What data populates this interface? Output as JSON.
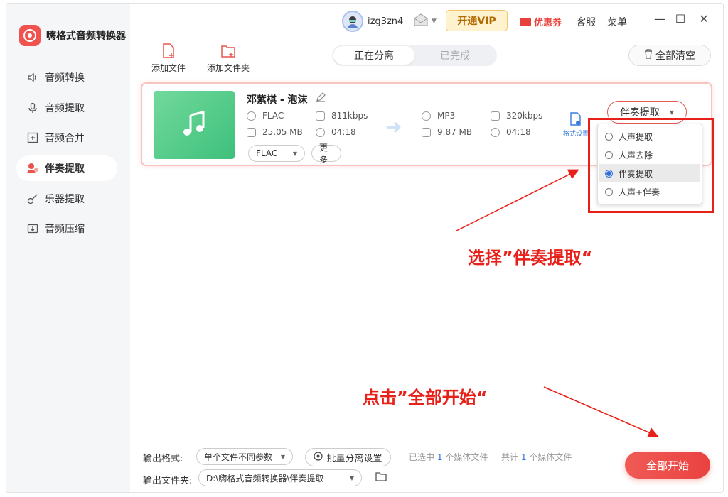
{
  "app": {
    "title": "嗨格式音频转换器"
  },
  "sidebar": {
    "items": [
      {
        "label": "音频转换",
        "icon": "speaker-icon",
        "active": false
      },
      {
        "label": "音频提取",
        "icon": "mic-icon",
        "active": false
      },
      {
        "label": "音频合并",
        "icon": "merge-icon",
        "active": false
      },
      {
        "label": "伴奏提取",
        "icon": "accompaniment-icon",
        "active": true
      },
      {
        "label": "乐器提取",
        "icon": "guitar-icon",
        "active": false
      },
      {
        "label": "音频压缩",
        "icon": "compress-icon",
        "active": false
      }
    ]
  },
  "topbar": {
    "username": "izg3zn4",
    "vip": "开通VIP",
    "coupon": "优惠券",
    "service": "客服",
    "menu": "菜单",
    "minimize": "—",
    "maximize": "☐",
    "close": "✕"
  },
  "toolbar": {
    "add_file": "添加文件",
    "add_folder": "添加文件夹",
    "tab_separating": "正在分离",
    "tab_done": "已完成",
    "clear_all": "全部清空"
  },
  "file": {
    "title": "邓紫棋 - 泡沫",
    "src": {
      "format": "FLAC",
      "bitrate": "811kbps",
      "size": "25.05 MB",
      "duration": "04:18"
    },
    "dst": {
      "format": "MP3",
      "bitrate": "320kbps",
      "size": "9.87 MB",
      "duration": "04:18"
    },
    "format_select": "FLAC",
    "more": "更多",
    "format_settings": "格式设置",
    "extract_mode": "伴奏提取"
  },
  "dropdown": {
    "options": [
      {
        "label": "人声提取",
        "selected": false
      },
      {
        "label": "人声去除",
        "selected": false
      },
      {
        "label": "伴奏提取",
        "selected": true
      },
      {
        "label": "人声+伴奏",
        "selected": false
      }
    ]
  },
  "annotations": {
    "select_hint": "选择”伴奏提取“",
    "start_hint": "点击”全部开始“"
  },
  "bottom": {
    "output_format_label": "输出格式:",
    "output_format_value": "单个文件不同参数",
    "batch_settings": "批量分离设置",
    "selected_prefix": "已选中",
    "selected_count": "1",
    "selected_suffix": "个媒体文件",
    "total_prefix": "共计",
    "total_count": "1",
    "total_suffix": "个媒体文件",
    "output_folder_label": "输出文件夹:",
    "output_folder_value": "D:\\嗨格式音频转换器\\伴奏提取",
    "start_all": "全部开始"
  },
  "colors": {
    "accent": "#ea4240",
    "highlight_red": "#e8201a",
    "link_blue": "#2f6fdc",
    "vip_bg": "#fff3cf"
  }
}
